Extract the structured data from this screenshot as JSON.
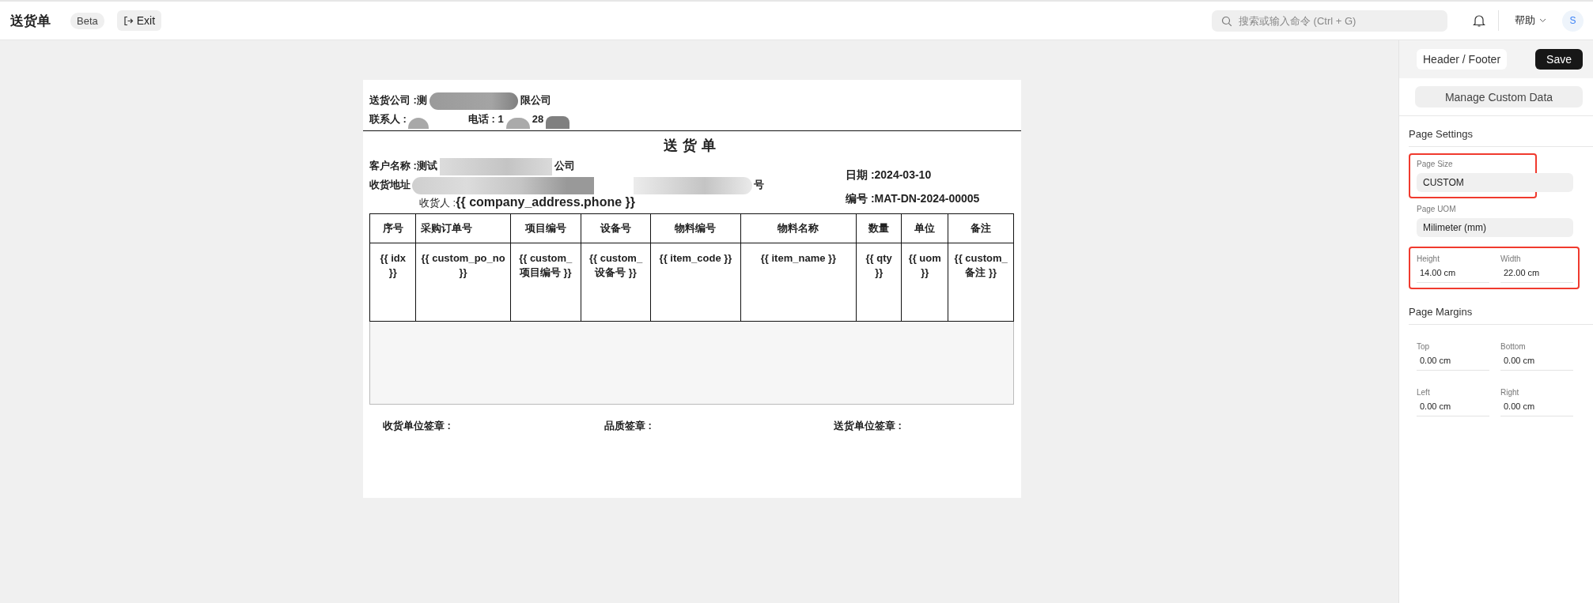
{
  "topbar": {
    "title": "送货单",
    "badge": "Beta",
    "exit": "Exit",
    "search": {
      "placeholder": "搜索或输入命令 (Ctrl + G)"
    },
    "help": "帮助",
    "avatar": "S"
  },
  "document": {
    "sender_label": "送货公司 :测",
    "sender_tail": "限公司",
    "contact_label": "联系人 :",
    "phone_label": "电话 : 1",
    "phone_mid": "28",
    "title": "送货单",
    "customer_label": "客户名称 :测试",
    "customer_tail": "公司",
    "address_label": "收货地址",
    "address_tail": "号",
    "receiver": "收货人 :**{{ company_address.phone }}**",
    "date": "日期 :2024-03-10",
    "number": "编号 :MAT-DN-2024-00005",
    "table": {
      "columns": [
        "序号",
        "采购订单号",
        "项目编号",
        "设备号",
        "物料编号",
        "物料名称",
        "数量",
        "单位",
        "备注"
      ],
      "rows": [
        [
          "{{ idx }}",
          "{{ custom_po_no }}",
          "{{ custom_项目编号 }}",
          "{{ custom_设备号 }}",
          "{{ item_code }}",
          "{{ item_name }}",
          "{{ qty }}",
          "{{ uom }}",
          "{{ custom_备注 }}"
        ]
      ]
    },
    "signatures": [
      "收货单位签章 :",
      "品质签章 :",
      "送货单位签章 :"
    ]
  },
  "panel": {
    "header_footer": "Header / Footer",
    "save": "Save",
    "manage": "Manage Custom Data",
    "sections": [
      {
        "title": "Page Settings",
        "groups": [
          {
            "kind": "select",
            "highlighted": true,
            "fields": [
              {
                "label": "Page Size",
                "value": "CUSTOM"
              }
            ]
          },
          {
            "kind": "select",
            "highlighted": false,
            "fields": [
              {
                "label": "Page UOM",
                "value": "Milimeter (mm)"
              }
            ]
          },
          {
            "kind": "pair",
            "highlighted": true,
            "fields": [
              {
                "label": "Height",
                "value": "14.00 cm"
              },
              {
                "label": "Width",
                "value": "22.00 cm"
              }
            ]
          }
        ]
      },
      {
        "title": "Page Margins",
        "groups": [
          {
            "kind": "pair",
            "highlighted": false,
            "fields": [
              {
                "label": "Top",
                "value": "0.00 cm"
              },
              {
                "label": "Bottom",
                "value": "0.00 cm"
              }
            ]
          },
          {
            "kind": "pair",
            "highlighted": false,
            "fields": [
              {
                "label": "Left",
                "value": "0.00 cm"
              },
              {
                "label": "Right",
                "value": "0.00 cm"
              }
            ]
          }
        ]
      }
    ]
  }
}
